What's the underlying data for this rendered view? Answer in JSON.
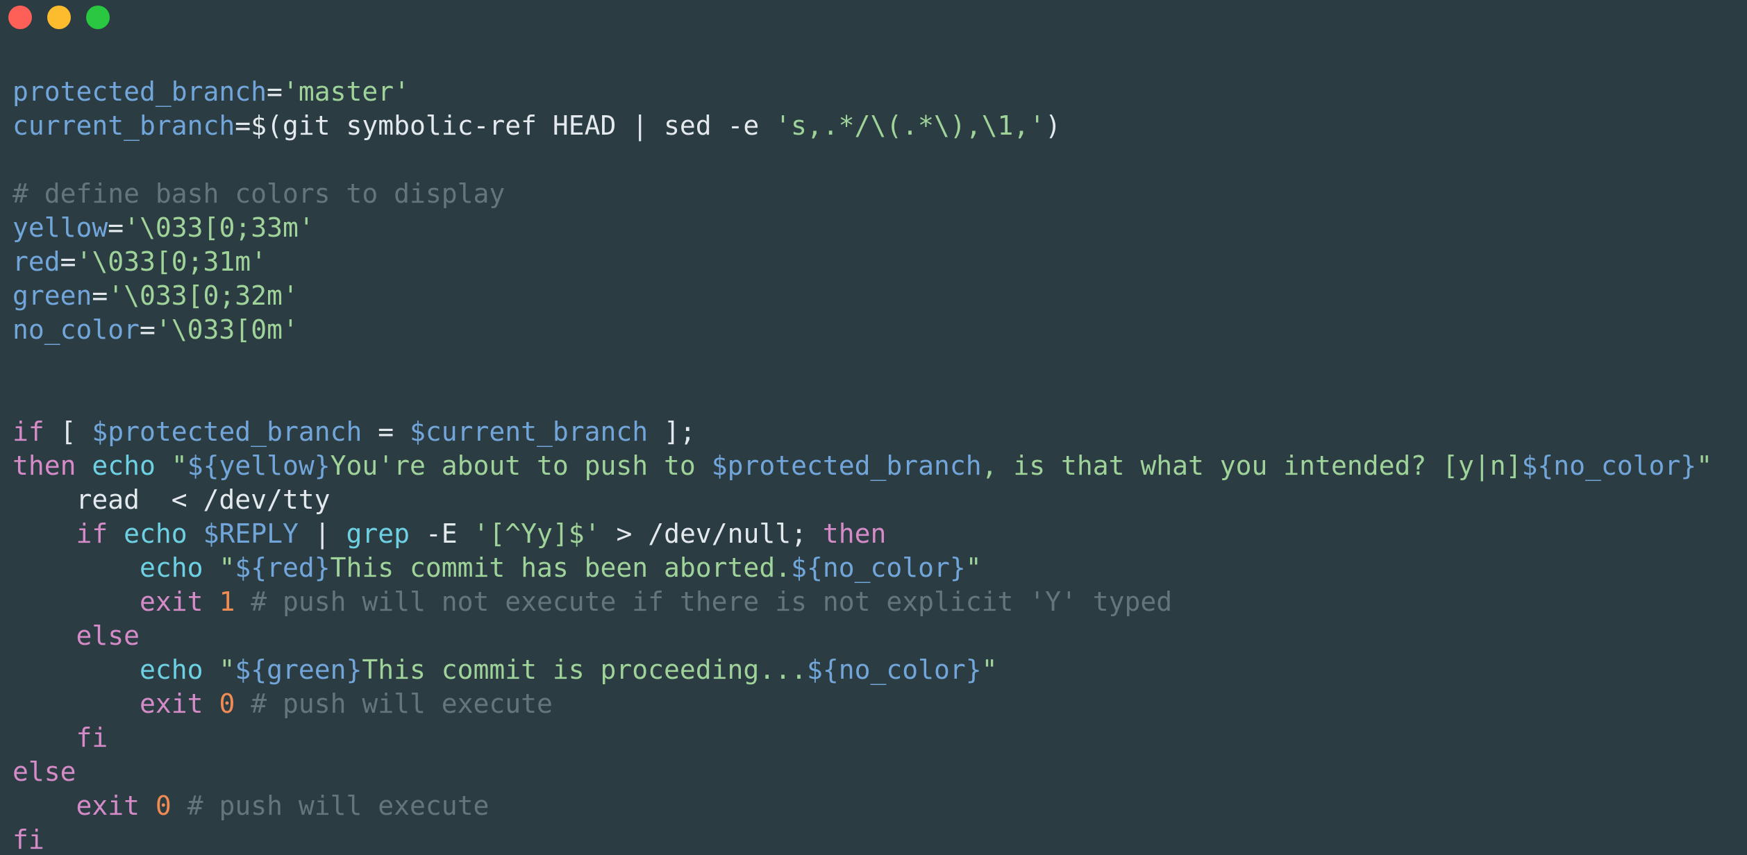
{
  "window": {
    "controls": [
      {
        "name": "close",
        "color": "#fe5f57"
      },
      {
        "name": "minimize",
        "color": "#fdbc2e"
      },
      {
        "name": "maximize",
        "color": "#29c840"
      }
    ]
  },
  "colors": {
    "background": "#2b3d43",
    "variable": "#72a6da",
    "string": "#9fd39a",
    "comment": "#66757c",
    "keyword": "#d58bc7",
    "command": "#6ed1e3",
    "number": "#f08b55",
    "plain": "#e3e9ec"
  },
  "code": {
    "lines": [
      [
        {
          "t": "protected_branch",
          "c": "var"
        },
        {
          "t": "=",
          "c": "plain"
        },
        {
          "t": "'master'",
          "c": "str"
        }
      ],
      [
        {
          "t": "current_branch",
          "c": "var"
        },
        {
          "t": "=$(git symbolic-ref HEAD | sed -e ",
          "c": "plain"
        },
        {
          "t": "'s,.*/\\(.*\\),\\1,'",
          "c": "str"
        },
        {
          "t": ")",
          "c": "plain"
        }
      ],
      [],
      [
        {
          "t": "# define bash colors to display",
          "c": "cmt"
        }
      ],
      [
        {
          "t": "yellow",
          "c": "var"
        },
        {
          "t": "=",
          "c": "plain"
        },
        {
          "t": "'\\033[0;33m'",
          "c": "str"
        }
      ],
      [
        {
          "t": "red",
          "c": "var"
        },
        {
          "t": "=",
          "c": "plain"
        },
        {
          "t": "'\\033[0;31m'",
          "c": "str"
        }
      ],
      [
        {
          "t": "green",
          "c": "var"
        },
        {
          "t": "=",
          "c": "plain"
        },
        {
          "t": "'\\033[0;32m'",
          "c": "str"
        }
      ],
      [
        {
          "t": "no_color",
          "c": "var"
        },
        {
          "t": "=",
          "c": "plain"
        },
        {
          "t": "'\\033[0m'",
          "c": "str"
        }
      ],
      [],
      [],
      [
        {
          "t": "if",
          "c": "kw"
        },
        {
          "t": " [ ",
          "c": "plain"
        },
        {
          "t": "$protected_branch",
          "c": "var"
        },
        {
          "t": " = ",
          "c": "plain"
        },
        {
          "t": "$current_branch",
          "c": "var"
        },
        {
          "t": " ];",
          "c": "plain"
        }
      ],
      [
        {
          "t": "then",
          "c": "kw"
        },
        {
          "t": " ",
          "c": "plain"
        },
        {
          "t": "echo",
          "c": "cmd"
        },
        {
          "t": " ",
          "c": "plain"
        },
        {
          "t": "\"",
          "c": "str"
        },
        {
          "t": "${yellow}",
          "c": "var"
        },
        {
          "t": "You're about to push to ",
          "c": "str"
        },
        {
          "t": "$protected_branch",
          "c": "var"
        },
        {
          "t": ", is that what you intended? [y|n]",
          "c": "str"
        },
        {
          "t": "${no_color}",
          "c": "var"
        },
        {
          "t": "\"",
          "c": "str"
        }
      ],
      [
        {
          "t": "    read  < /dev/tty",
          "c": "plain"
        }
      ],
      [
        {
          "t": "    ",
          "c": "plain"
        },
        {
          "t": "if",
          "c": "kw"
        },
        {
          "t": " ",
          "c": "plain"
        },
        {
          "t": "echo",
          "c": "cmd"
        },
        {
          "t": " ",
          "c": "plain"
        },
        {
          "t": "$REPLY",
          "c": "var"
        },
        {
          "t": " | ",
          "c": "plain"
        },
        {
          "t": "grep",
          "c": "cmd"
        },
        {
          "t": " -E ",
          "c": "plain"
        },
        {
          "t": "'[^Yy]$'",
          "c": "str"
        },
        {
          "t": " > /dev/null; ",
          "c": "plain"
        },
        {
          "t": "then",
          "c": "kw"
        }
      ],
      [
        {
          "t": "        ",
          "c": "plain"
        },
        {
          "t": "echo",
          "c": "cmd"
        },
        {
          "t": " ",
          "c": "plain"
        },
        {
          "t": "\"",
          "c": "str"
        },
        {
          "t": "${red}",
          "c": "var"
        },
        {
          "t": "This commit has been aborted.",
          "c": "str"
        },
        {
          "t": "${no_color}",
          "c": "var"
        },
        {
          "t": "\"",
          "c": "str"
        }
      ],
      [
        {
          "t": "        ",
          "c": "plain"
        },
        {
          "t": "exit",
          "c": "kw"
        },
        {
          "t": " ",
          "c": "plain"
        },
        {
          "t": "1",
          "c": "num"
        },
        {
          "t": " ",
          "c": "plain"
        },
        {
          "t": "# push will not execute if there is not explicit 'Y' typed",
          "c": "cmt"
        }
      ],
      [
        {
          "t": "    ",
          "c": "plain"
        },
        {
          "t": "else",
          "c": "kw"
        }
      ],
      [
        {
          "t": "        ",
          "c": "plain"
        },
        {
          "t": "echo",
          "c": "cmd"
        },
        {
          "t": " ",
          "c": "plain"
        },
        {
          "t": "\"",
          "c": "str"
        },
        {
          "t": "${green}",
          "c": "var"
        },
        {
          "t": "This commit is proceeding...",
          "c": "str"
        },
        {
          "t": "${no_color}",
          "c": "var"
        },
        {
          "t": "\"",
          "c": "str"
        }
      ],
      [
        {
          "t": "        ",
          "c": "plain"
        },
        {
          "t": "exit",
          "c": "kw"
        },
        {
          "t": " ",
          "c": "plain"
        },
        {
          "t": "0",
          "c": "num"
        },
        {
          "t": " ",
          "c": "plain"
        },
        {
          "t": "# push will execute",
          "c": "cmt"
        }
      ],
      [
        {
          "t": "    ",
          "c": "plain"
        },
        {
          "t": "fi",
          "c": "kw"
        }
      ],
      [
        {
          "t": "else",
          "c": "kw"
        }
      ],
      [
        {
          "t": "    ",
          "c": "plain"
        },
        {
          "t": "exit",
          "c": "kw"
        },
        {
          "t": " ",
          "c": "plain"
        },
        {
          "t": "0",
          "c": "num"
        },
        {
          "t": " ",
          "c": "plain"
        },
        {
          "t": "# push will execute",
          "c": "cmt"
        }
      ],
      [
        {
          "t": "fi",
          "c": "kw"
        }
      ]
    ]
  }
}
